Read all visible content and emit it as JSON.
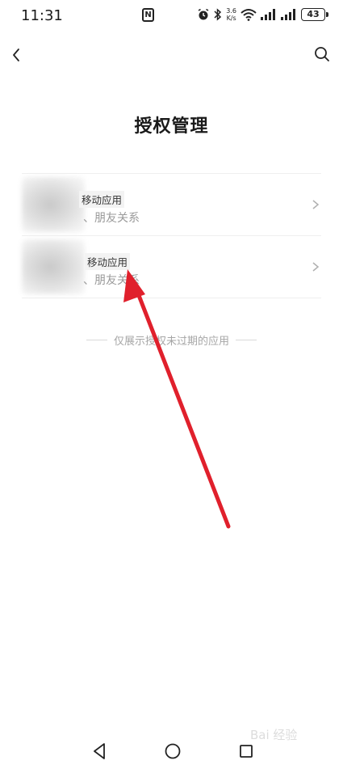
{
  "status_bar": {
    "time": "11:31",
    "nfc": "N",
    "net_speed_value": "3.6",
    "net_speed_unit": "K/s",
    "battery": "43"
  },
  "header": {
    "title": "授权管理"
  },
  "apps": [
    {
      "name": "移动应用",
      "scope": "、朋友关系"
    },
    {
      "name": "移动应用",
      "scope": "、朋友关系"
    }
  ],
  "footer_note": "仅展示授权未过期的应用",
  "watermark": "Bai 经验",
  "colors": {
    "annotation_arrow": "#e0202c",
    "divider": "#efefef",
    "muted_text": "#9a9a9a"
  },
  "icons": {
    "back": "chevron-left-icon",
    "search": "search-icon",
    "row_chevron": "chevron-right-icon",
    "nav_back": "triangle-back-icon",
    "nav_home": "circle-home-icon",
    "nav_recent": "square-recent-icon"
  }
}
